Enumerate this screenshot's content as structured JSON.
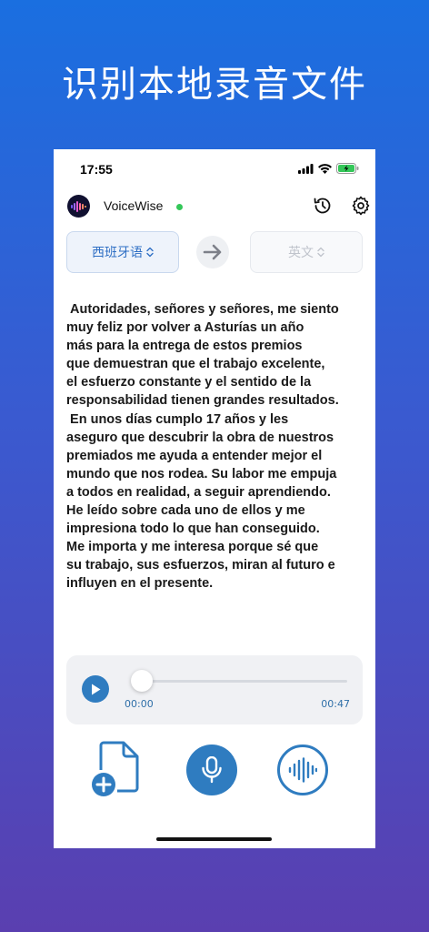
{
  "headline": "识别本地录音文件",
  "status_bar": {
    "time": "17:55"
  },
  "app": {
    "name": "VoiceWise",
    "online_color": "#34c759"
  },
  "language": {
    "source": "西班牙语",
    "target": "英文"
  },
  "transcript": " Autoridades, señores y señores, me siento\nmuy feliz por volver a Asturías un año\nmás para la entrega de estos premios\nque demuestran que el trabajo excelente,\nel esfuerzo constante y el sentido de la\nresponsabilidad tienen grandes resultados.\n En unos días cumplo 17 años y les\naseguro que descubrir la obra de nuestros\npremiados me ayuda a entender mejor el\nmundo que nos rodea. Su labor me empuja\na todos en realidad, a seguir aprendiendo.\nHe leído sobre cada uno de ellos y me\nimpresiona todo lo que han conseguido.\nMe importa y me interesa porque sé que\nsu trabajo, sus esfuerzos, miran al futuro e\ninfluyen en el presente.",
  "player": {
    "current_time": "00:00",
    "total_time": "00:47",
    "progress": 0.0
  },
  "colors": {
    "accent": "#2f7cc0",
    "background_top": "#1a6fe0",
    "background_bottom": "#5a3fb0"
  },
  "icons": {
    "history": "history-icon",
    "settings": "gear-icon",
    "swap": "arrow-right-icon",
    "play": "play-icon",
    "import": "add-file-icon",
    "mic": "microphone-icon",
    "waveform": "waveform-icon"
  }
}
